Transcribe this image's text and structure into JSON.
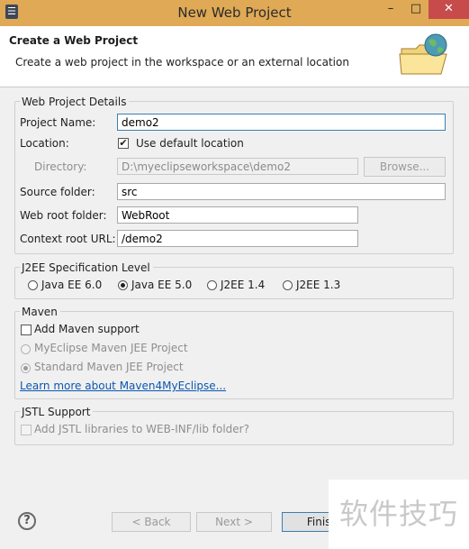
{
  "window": {
    "title": "New Web Project",
    "app_icon_glyph": "☰",
    "minimize": "–",
    "maximize": "□",
    "close": "✕"
  },
  "header": {
    "title": "Create a Web Project",
    "subtitle": "Create a web project in the workspace or an external location",
    "graphic_icon": "globe-folder-icon"
  },
  "details": {
    "legend": "Web Project Details",
    "project_name_label": "Project Name:",
    "project_name_value": "demo2",
    "location_label": "Location:",
    "use_default_location_label": "Use default location",
    "use_default_location_checked": true,
    "directory_label": "Directory:",
    "directory_value": "D:\\myeclipseworkspace\\demo2",
    "browse_label": "Browse...",
    "source_folder_label": "Source folder:",
    "source_folder_value": "src",
    "web_root_label": "Web root folder:",
    "web_root_value": "WebRoot",
    "context_root_label": "Context root URL:",
    "context_root_value": "/demo2"
  },
  "j2ee": {
    "legend": "J2EE Specification Level",
    "options": [
      "Java EE 6.0",
      "Java EE 5.0",
      "J2EE 1.4",
      "J2EE 1.3"
    ],
    "selected": "Java EE 5.0"
  },
  "maven": {
    "legend": "Maven",
    "add_support_label": "Add Maven support",
    "add_support_checked": false,
    "myeclipse_option": "MyEclipse Maven JEE Project",
    "standard_option": "Standard Maven JEE Project",
    "learn_more": "Learn more about Maven4MyEclipse..."
  },
  "jstl": {
    "legend": "JSTL Support",
    "add_label": "Add JSTL libraries to WEB-INF/lib folder?",
    "add_checked": false
  },
  "footer": {
    "help_glyph": "?",
    "back_label": "< Back",
    "next_label": "Next >",
    "finish_label": "Finish"
  },
  "watermark": "软件技巧",
  "colors": {
    "titlebar": "#dfa956",
    "dialog_bg": "#f0f0f0",
    "link": "#0b57b2",
    "close": "#c74b4b"
  }
}
